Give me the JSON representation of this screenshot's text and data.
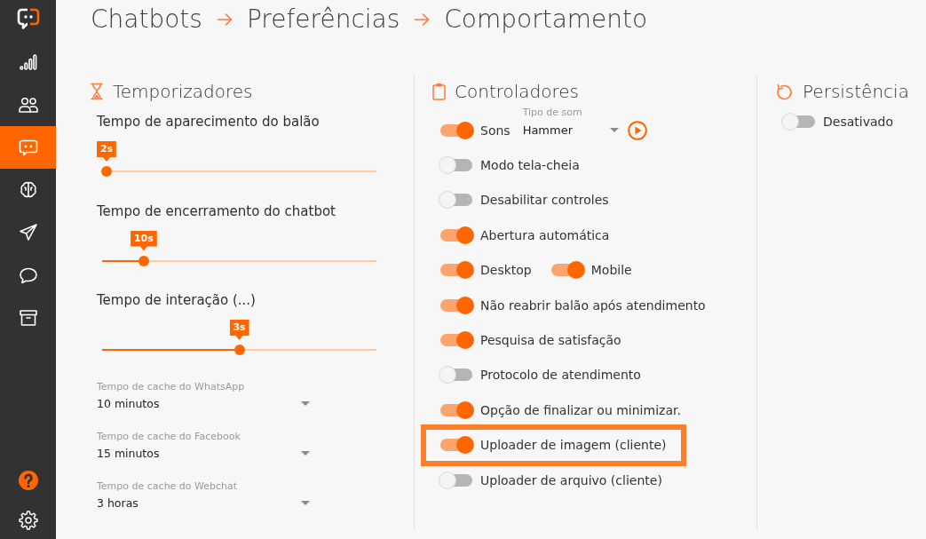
{
  "sidebar": {
    "nav": [
      {
        "selected": false
      },
      {
        "selected": false
      },
      {
        "selected": true
      },
      {
        "selected": false
      },
      {
        "selected": false
      },
      {
        "selected": false
      },
      {
        "selected": false
      }
    ]
  },
  "breadcrumb": [
    "Chatbots",
    "Preferências",
    "Comportamento"
  ],
  "timers": {
    "title": "Temporizadores",
    "sliders": [
      {
        "label": "Tempo de aparecimento do balão",
        "value": "2s",
        "level": 0
      },
      {
        "label": "Tempo de encerramento do chatbot",
        "value": "10s",
        "level": 0.14
      },
      {
        "label": "Tempo de interação (...)",
        "value": "3s",
        "level": 0.5
      }
    ],
    "selects": [
      {
        "label": "Tempo de cache do WhatsApp",
        "value": "10 minutos"
      },
      {
        "label": "Tempo de cache do Facebook",
        "value": "15 minutos"
      },
      {
        "label": "Tempo de cache do Webchat",
        "value": "3 horas"
      }
    ]
  },
  "controllers": {
    "title": "Controladores",
    "rows": [
      {
        "kind": "sound",
        "highlighted": false,
        "toggles": [
          {
            "label": "Sons",
            "on": true
          }
        ],
        "select": {
          "label": "Tipo de som",
          "value": "Hammer"
        }
      },
      {
        "kind": "switch",
        "highlighted": false,
        "toggles": [
          {
            "label": "Modo tela-cheia",
            "on": false
          }
        ]
      },
      {
        "kind": "switch",
        "highlighted": false,
        "toggles": [
          {
            "label": "Desabilitar controles",
            "on": false
          }
        ]
      },
      {
        "kind": "switch",
        "highlighted": false,
        "toggles": [
          {
            "label": "Abertura automática",
            "on": true
          }
        ]
      },
      {
        "kind": "switch",
        "highlighted": false,
        "toggles": [
          {
            "label": "Desktop",
            "on": true
          },
          {
            "label": "Mobile",
            "on": true
          }
        ]
      },
      {
        "kind": "switch",
        "highlighted": false,
        "toggles": [
          {
            "label": "Não reabrir balão após atendimento",
            "on": true
          }
        ]
      },
      {
        "kind": "switch",
        "highlighted": false,
        "toggles": [
          {
            "label": "Pesquisa de satisfação",
            "on": true
          }
        ]
      },
      {
        "kind": "switch",
        "highlighted": false,
        "toggles": [
          {
            "label": "Protocolo de atendimento",
            "on": false
          }
        ]
      },
      {
        "kind": "switch",
        "highlighted": false,
        "toggles": [
          {
            "label": "Opção de finalizar ou minimizar.",
            "on": true
          }
        ]
      },
      {
        "kind": "switch",
        "highlighted": true,
        "toggles": [
          {
            "label": "Uploader de imagem (cliente)",
            "on": true
          }
        ]
      },
      {
        "kind": "switch",
        "highlighted": false,
        "toggles": [
          {
            "label": "Uploader de arquivo (cliente)",
            "on": false
          }
        ]
      }
    ]
  },
  "persistence": {
    "title": "Persistência",
    "toggle": {
      "label": "Desativado",
      "on": false
    }
  }
}
